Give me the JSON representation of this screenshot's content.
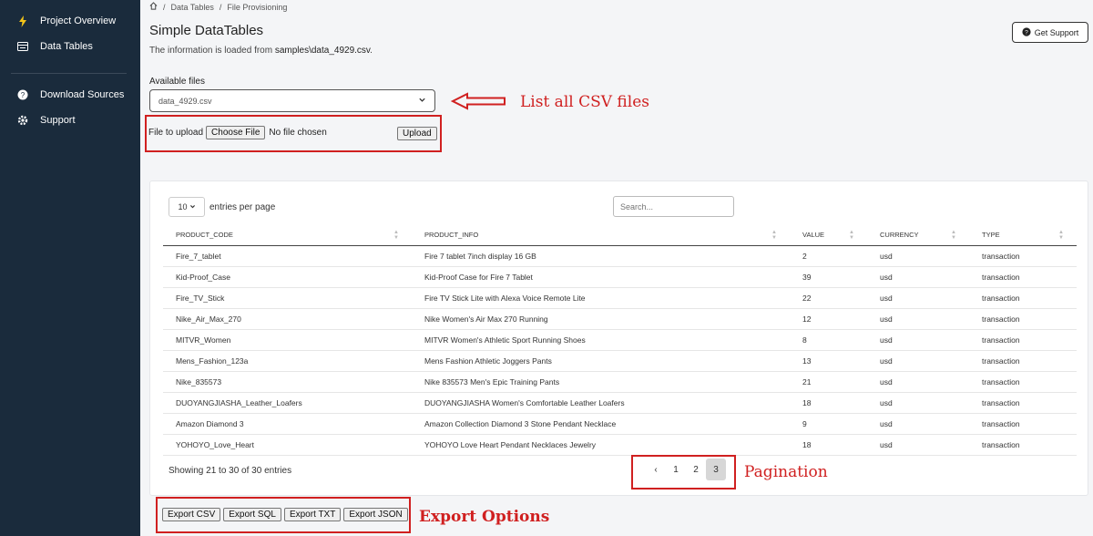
{
  "sidebar": {
    "items": [
      {
        "label": "Project Overview",
        "icon": "bolt-icon"
      },
      {
        "label": "Data Tables",
        "icon": "table-icon"
      },
      {
        "label": "Download Sources",
        "icon": "help-circle-icon"
      },
      {
        "label": "Support",
        "icon": "gear-icon"
      }
    ]
  },
  "breadcrumb": [
    "Data Tables",
    "File Provisioning"
  ],
  "page": {
    "title": "Simple DataTables",
    "desc_prefix": "The information is loaded from ",
    "desc_file": "samples\\data_4929.csv",
    "desc_suffix": "."
  },
  "support_button": "Get Support",
  "files": {
    "label": "Available files",
    "selected": "data_4929.csv"
  },
  "upload": {
    "label": "File to upload",
    "choose": "Choose File",
    "status": "No file chosen",
    "button": "Upload"
  },
  "annotations": {
    "csv": "List all CSV files",
    "pagination": "Pagination",
    "export": "Export Options"
  },
  "table": {
    "per_page_value": "10",
    "per_page_label": "entries per page",
    "search_placeholder": "Search...",
    "columns": [
      "PRODUCT_CODE",
      "PRODUCT_INFO",
      "VALUE",
      "CURRENCY",
      "TYPE"
    ],
    "rows": [
      [
        "Fire_7_tablet",
        "Fire 7 tablet 7inch display 16 GB",
        "2",
        "usd",
        "transaction"
      ],
      [
        "Kid-Proof_Case",
        "Kid-Proof Case for Fire 7 Tablet",
        "39",
        "usd",
        "transaction"
      ],
      [
        "Fire_TV_Stick",
        "Fire TV Stick Lite with Alexa Voice Remote Lite",
        "22",
        "usd",
        "transaction"
      ],
      [
        "Nike_Air_Max_270",
        "Nike Women's Air Max 270 Running",
        "12",
        "usd",
        "transaction"
      ],
      [
        "MITVR_Women",
        "MITVR Women's Athletic Sport Running Shoes",
        "8",
        "usd",
        "transaction"
      ],
      [
        "Mens_Fashion_123a",
        "Mens Fashion Athletic Joggers Pants",
        "13",
        "usd",
        "transaction"
      ],
      [
        "Nike_835573",
        "Nike 835573 Men's Epic Training Pants",
        "21",
        "usd",
        "transaction"
      ],
      [
        "DUOYANGJIASHA_Leather_Loafers",
        "DUOYANGJIASHA Women's Comfortable Leather Loafers",
        "18",
        "usd",
        "transaction"
      ],
      [
        "Amazon Diamond 3",
        "Amazon Collection Diamond 3 Stone Pendant Necklace",
        "9",
        "usd",
        "transaction"
      ],
      [
        "YOHOYO_Love_Heart",
        "YOHOYO Love Heart Pendant Necklaces Jewelry",
        "18",
        "usd",
        "transaction"
      ]
    ],
    "showing": "Showing 21 to 30 of 30 entries"
  },
  "pagination": {
    "prev": "‹",
    "pages": [
      "1",
      "2",
      "3"
    ],
    "active": "3"
  },
  "exports": [
    "Export CSV",
    "Export SQL",
    "Export TXT",
    "Export JSON"
  ],
  "colors": {
    "sidebar_bg": "#1a2b3c",
    "annotation_red": "#d02020",
    "bolt": "#f5c518"
  }
}
